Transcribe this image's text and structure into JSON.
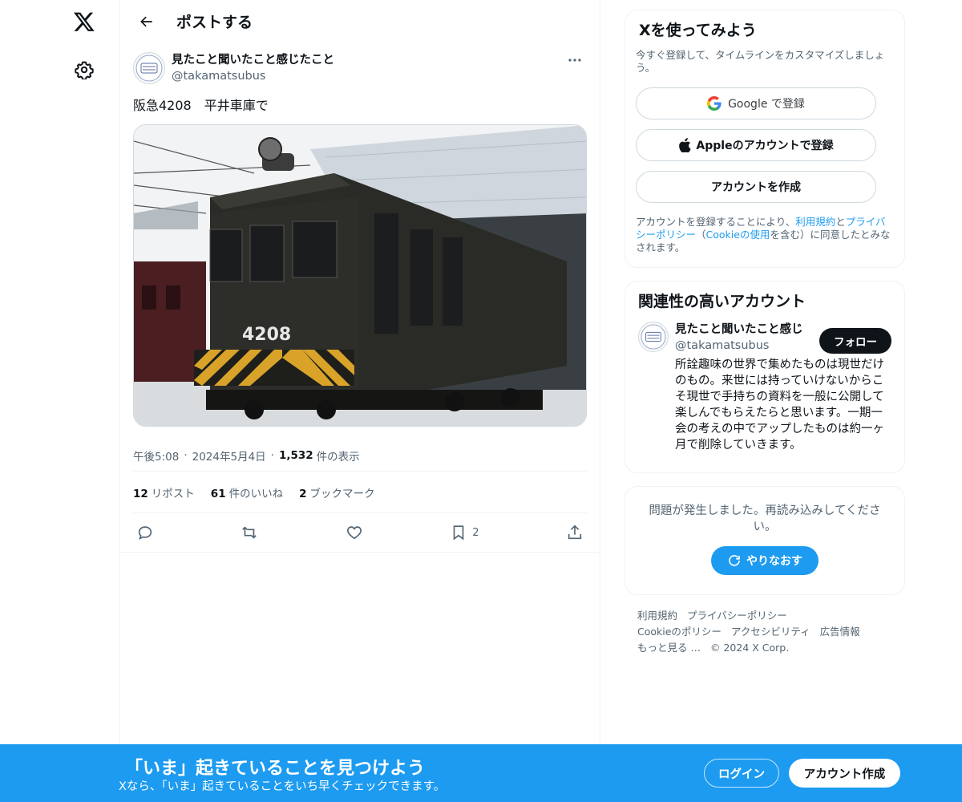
{
  "nav": {
    "logo_icon": "x-logo-icon",
    "settings_icon": "gear-icon"
  },
  "header": {
    "title": "ポストする",
    "back_icon": "arrow-left-icon"
  },
  "post": {
    "author_name": "見たこと聞いたこと感じたこと",
    "author_handle": "@takamatsubus",
    "text": "阪急4208　平井車庫で",
    "image_number": "4208",
    "time": "午後5:08",
    "date": "2024年5月4日",
    "views_count": "1,532",
    "views_label": "件の表示",
    "reposts_count": "12",
    "reposts_label": "リポスト",
    "likes_count": "61",
    "likes_label": "件のいいね",
    "bookmarks_count": "2",
    "bookmarks_label": "ブックマーク",
    "bookmark_action_count": "2"
  },
  "signup": {
    "title": "Xを使ってみよう",
    "subtitle": "今すぐ登録して、タイムラインをカスタマイズしましょう。",
    "google_label": "Google で登録",
    "apple_label": "Appleのアカウントで登録",
    "create_label": "アカウントを作成",
    "terms_pre": "アカウントを登録することにより、",
    "terms_link": "利用規約",
    "terms_and": "と",
    "privacy_link": "プライバシーポリシー",
    "terms_mid": "（",
    "cookie_link": "Cookieの使用",
    "terms_post": "を含む）に同意したとみなされます。"
  },
  "related": {
    "title": "関連性の高いアカウント",
    "name": "見たこと聞いたこと感じ",
    "handle": "@takamatsubus",
    "follow_label": "フォロー",
    "bio": "所詮趣味の世界で集めたものは現世だけのもの。来世には持っていけないからこそ現世で手持ちの資料を一般に公開して楽しんでもらえたらと思います。一期一会の考えの中でアップしたものは約一ヶ月で削除していきます。"
  },
  "error": {
    "text": "問題が発生しました。再読み込みしてください。",
    "retry_label": "やりなおす"
  },
  "footer": {
    "links": [
      "利用規約",
      "プライバシーポリシー",
      "Cookieのポリシー",
      "アクセシビリティ",
      "広告情報",
      "もっと見る …",
      "© 2024 X Corp."
    ]
  },
  "banner": {
    "title": "「いま」起きていることを見つけよう",
    "subtitle": "Xなら、「いま」起きていることをいち早くチェックできます。",
    "login_label": "ログイン",
    "signup_label": "アカウント作成"
  },
  "colors": {
    "accent": "#1d9bf0",
    "text": "#0f1419",
    "muted": "#536471",
    "border": "#eff3f4"
  }
}
